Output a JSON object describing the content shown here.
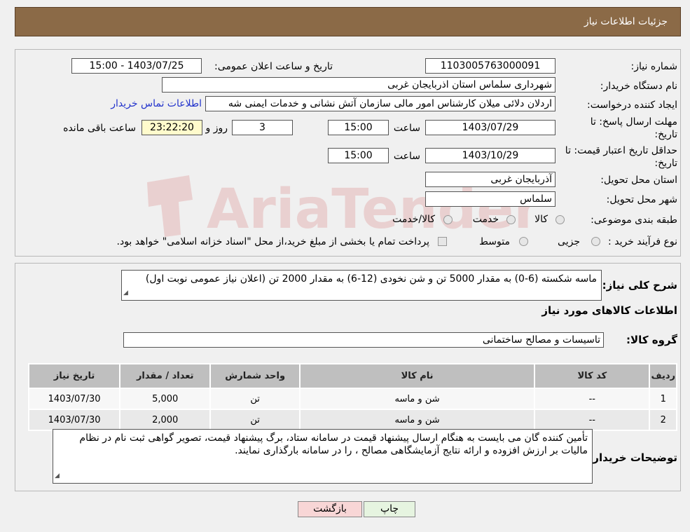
{
  "header": {
    "title": "جزئیات اطلاعات نیاز"
  },
  "form": {
    "need_number_label": "شماره نیاز:",
    "need_number": "1103005763000091",
    "announce_label": "تاریخ و ساعت اعلان عمومی:",
    "announce_value": "1403/07/25 - 15:00",
    "buyer_org_label": "نام دستگاه خریدار:",
    "buyer_org": "شهرداری سلماس استان اذربایجان غربی",
    "creator_label": "ایجاد کننده درخواست:",
    "creator": "اردلان دلائی میلان کارشناس امور مالی سازمان آتش نشانی و خدمات ایمنی شه",
    "buyer_contact_link": "اطلاعات تماس خریدار",
    "deadline_label_1": "مهلت ارسال پاسخ: تا",
    "deadline_label_2": "تاریخ:",
    "deadline_date": "1403/07/29",
    "time_label": "ساعت",
    "deadline_time": "15:00",
    "days_value": "3",
    "days_label": "روز و",
    "remaining_value": "23:22:20",
    "remaining_label": "ساعت باقی مانده",
    "validity_label_1": "حداقل تاریخ اعتبار قیمت: تا",
    "validity_label_2": "تاریخ:",
    "validity_date": "1403/10/29",
    "validity_time": "15:00",
    "province_label": "استان محل تحویل:",
    "province": "آذربایجان غربی",
    "city_label": "شهر محل تحویل:",
    "city": "سلماس",
    "category_label": "طبقه بندی موضوعی:",
    "category_options": [
      "کالا",
      "خدمت",
      "کالا/خدمت"
    ],
    "process_label": "نوع فرآیند خرید :",
    "process_options": [
      "جزیی",
      "متوسط"
    ],
    "payment_note": "پرداخت تمام یا بخشی از مبلغ خرید،از محل \"اسناد خزانه اسلامی\" خواهد بود."
  },
  "description": {
    "label": "شرح کلی نیاز:",
    "text": "ماسه شکسته (6-0)   به مقدار      5000   تن       و  شن نخودی (12-6) به مقدار 2000 تن (اعلان نیاز عمومی نوبت اول)"
  },
  "goods": {
    "section_title": "اطلاعات کالاهای مورد نیاز",
    "group_label": "گروه کالا:",
    "group_value": "تاسیسات و مصالح ساختمانی",
    "columns": [
      "ردیف",
      "کد کالا",
      "نام کالا",
      "واحد شمارش",
      "تعداد / مقدار",
      "تاریخ نیاز"
    ],
    "rows": [
      [
        "1",
        "--",
        "شن و ماسه",
        "تن",
        "5,000",
        "1403/07/30"
      ],
      [
        "2",
        "--",
        "شن و ماسه",
        "تن",
        "2,000",
        "1403/07/30"
      ]
    ]
  },
  "buyer_notes": {
    "label": "توضیحات خریدار:",
    "text": "تأمین کننده گان می بایست به هنگام ارسال پیشنهاد قیمت در سامانه ستاد، برگ پیشنهاد قیمت، تصویر گواهی ثبت نام در نظام مالیات بر ارزش افزوده و ارائه نتایج آزمایشگاهی مصالح ، را در سامانه بارگذاری نمایند."
  },
  "buttons": {
    "print": "چاپ",
    "back": "بازگشت"
  },
  "watermark": {
    "text": "AriaTender.neT"
  },
  "colors": {
    "header_bg": "#8b6a47",
    "link": "#2233cc",
    "back_btn": "#f8d6d6",
    "print_btn": "#e6f4e0"
  }
}
